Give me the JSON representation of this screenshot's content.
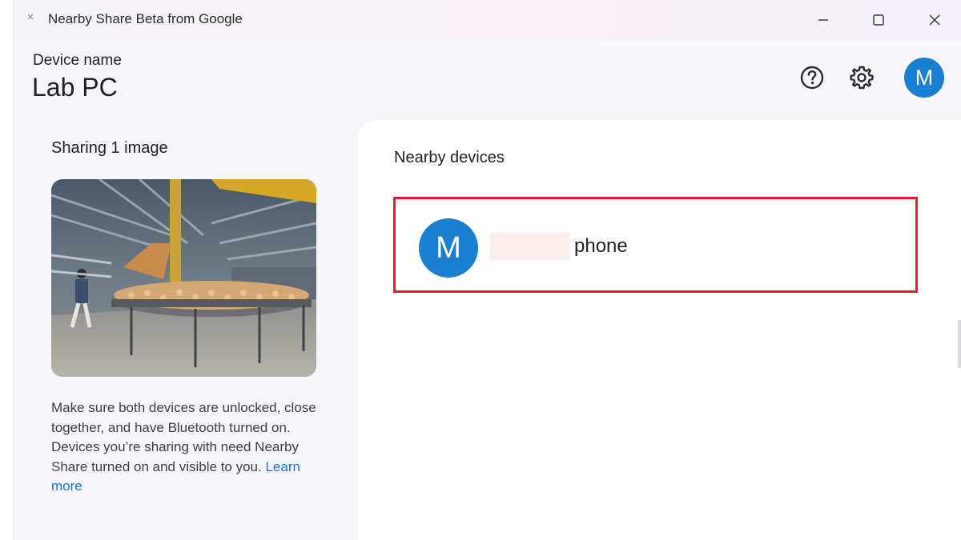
{
  "window": {
    "title": "Nearby Share Beta from Google",
    "icons": {
      "app": "nearby-share-icon",
      "minimize": "minimize-icon",
      "maximize": "maximize-icon",
      "close": "close-icon"
    }
  },
  "header": {
    "device_label": "Device name",
    "device_name": "Lab PC",
    "avatar_initial": "M",
    "icons": {
      "help": "help-icon",
      "settings": "gear-icon"
    }
  },
  "left": {
    "sharing_title": "Sharing 1 image",
    "help_text": "Make sure both devices are unlocked, close together, and have Bluetooth turned on. Devices you’re sharing with need Nearby Share turned on and visible to you.",
    "learn_more": "Learn more"
  },
  "right": {
    "title": "Nearby devices",
    "devices": [
      {
        "initial": "M",
        "name": "phone"
      }
    ]
  },
  "colors": {
    "accent": "#1a7fd1",
    "highlight": "#e02030",
    "link": "#1a73e8"
  }
}
